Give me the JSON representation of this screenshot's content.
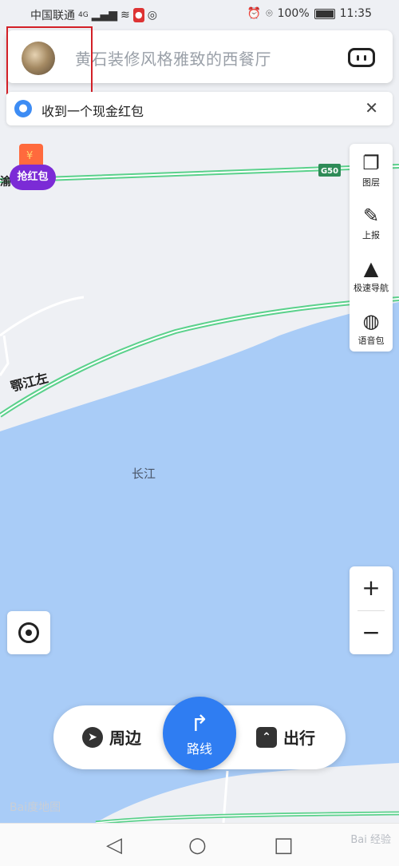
{
  "status_bar": {
    "carrier": "中国联通",
    "network": "4G",
    "battery": "100%",
    "time": "11:35"
  },
  "search": {
    "placeholder": "黄石装修风格雅致的西餐厅"
  },
  "notice": {
    "text": "收到一个现金红包"
  },
  "red_packet": {
    "label": "抢红包"
  },
  "map": {
    "highway_label": "G50",
    "river_label": "长江",
    "place_label": "鄂江左",
    "edge_label": "渝",
    "water_color": "#a9ccf7",
    "road_color": "#5ad18b"
  },
  "side_tools": [
    {
      "label": "图层",
      "icon": "layers-icon"
    },
    {
      "label": "上报",
      "icon": "report-icon"
    },
    {
      "label": "极速导航",
      "icon": "navigation-icon"
    },
    {
      "label": "语音包",
      "icon": "voice-pack-icon"
    }
  ],
  "zoom": {
    "in": "+",
    "out": "−"
  },
  "bottom_nav": {
    "nearby": "周边",
    "route": "路线",
    "trip": "出行"
  },
  "watermark": "Bai度地图",
  "corner_watermark": "Bai 经验",
  "accent_color": "#2f7df2"
}
